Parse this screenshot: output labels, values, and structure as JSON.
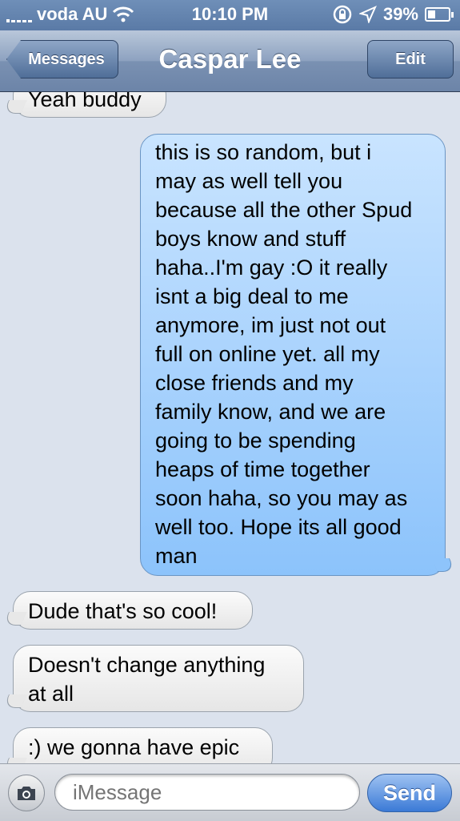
{
  "status_bar": {
    "carrier": "voda AU",
    "time": "10:10 PM",
    "battery": "39%",
    "battery_level": 0.39
  },
  "nav": {
    "back_label": "Messages",
    "title": "Caspar Lee",
    "edit_label": "Edit"
  },
  "messages": [
    {
      "direction": "incoming",
      "text": "Yeah buddy"
    },
    {
      "direction": "outgoing",
      "lines": [
        "this is so random, but i",
        "may as well tell you",
        "because all the other Spud",
        "boys know and stuff",
        "haha..I'm gay :O it really",
        "isnt a big deal to me",
        "anymore, im just not out",
        "full on online yet. all my",
        "close friends and my",
        "family know, and we are",
        "going to be spending",
        "heaps of time together",
        "soon haha, so you may as",
        "well too. Hope its all good",
        "man"
      ]
    },
    {
      "direction": "incoming",
      "text": "Dude that's so cool!"
    },
    {
      "direction": "incoming",
      "lines": [
        "Doesn't change anything",
        "at all"
      ]
    },
    {
      "direction": "incoming",
      "text": ":) we gonna have epic"
    }
  ],
  "input_bar": {
    "placeholder": "iMessage",
    "send_label": "Send"
  },
  "colors": {
    "nav_accent": "#6c84a8",
    "outgoing_bubble": "#8cc3fb",
    "incoming_bubble": "#ececec",
    "background": "#dbe2ed",
    "send_button": "#3b7ad6"
  },
  "icons": {
    "signal": "signal-icon",
    "wifi": "wifi-icon",
    "rotation_lock": "rotation-lock-icon",
    "location": "location-arrow-icon",
    "battery": "battery-icon",
    "camera": "camera-icon"
  }
}
